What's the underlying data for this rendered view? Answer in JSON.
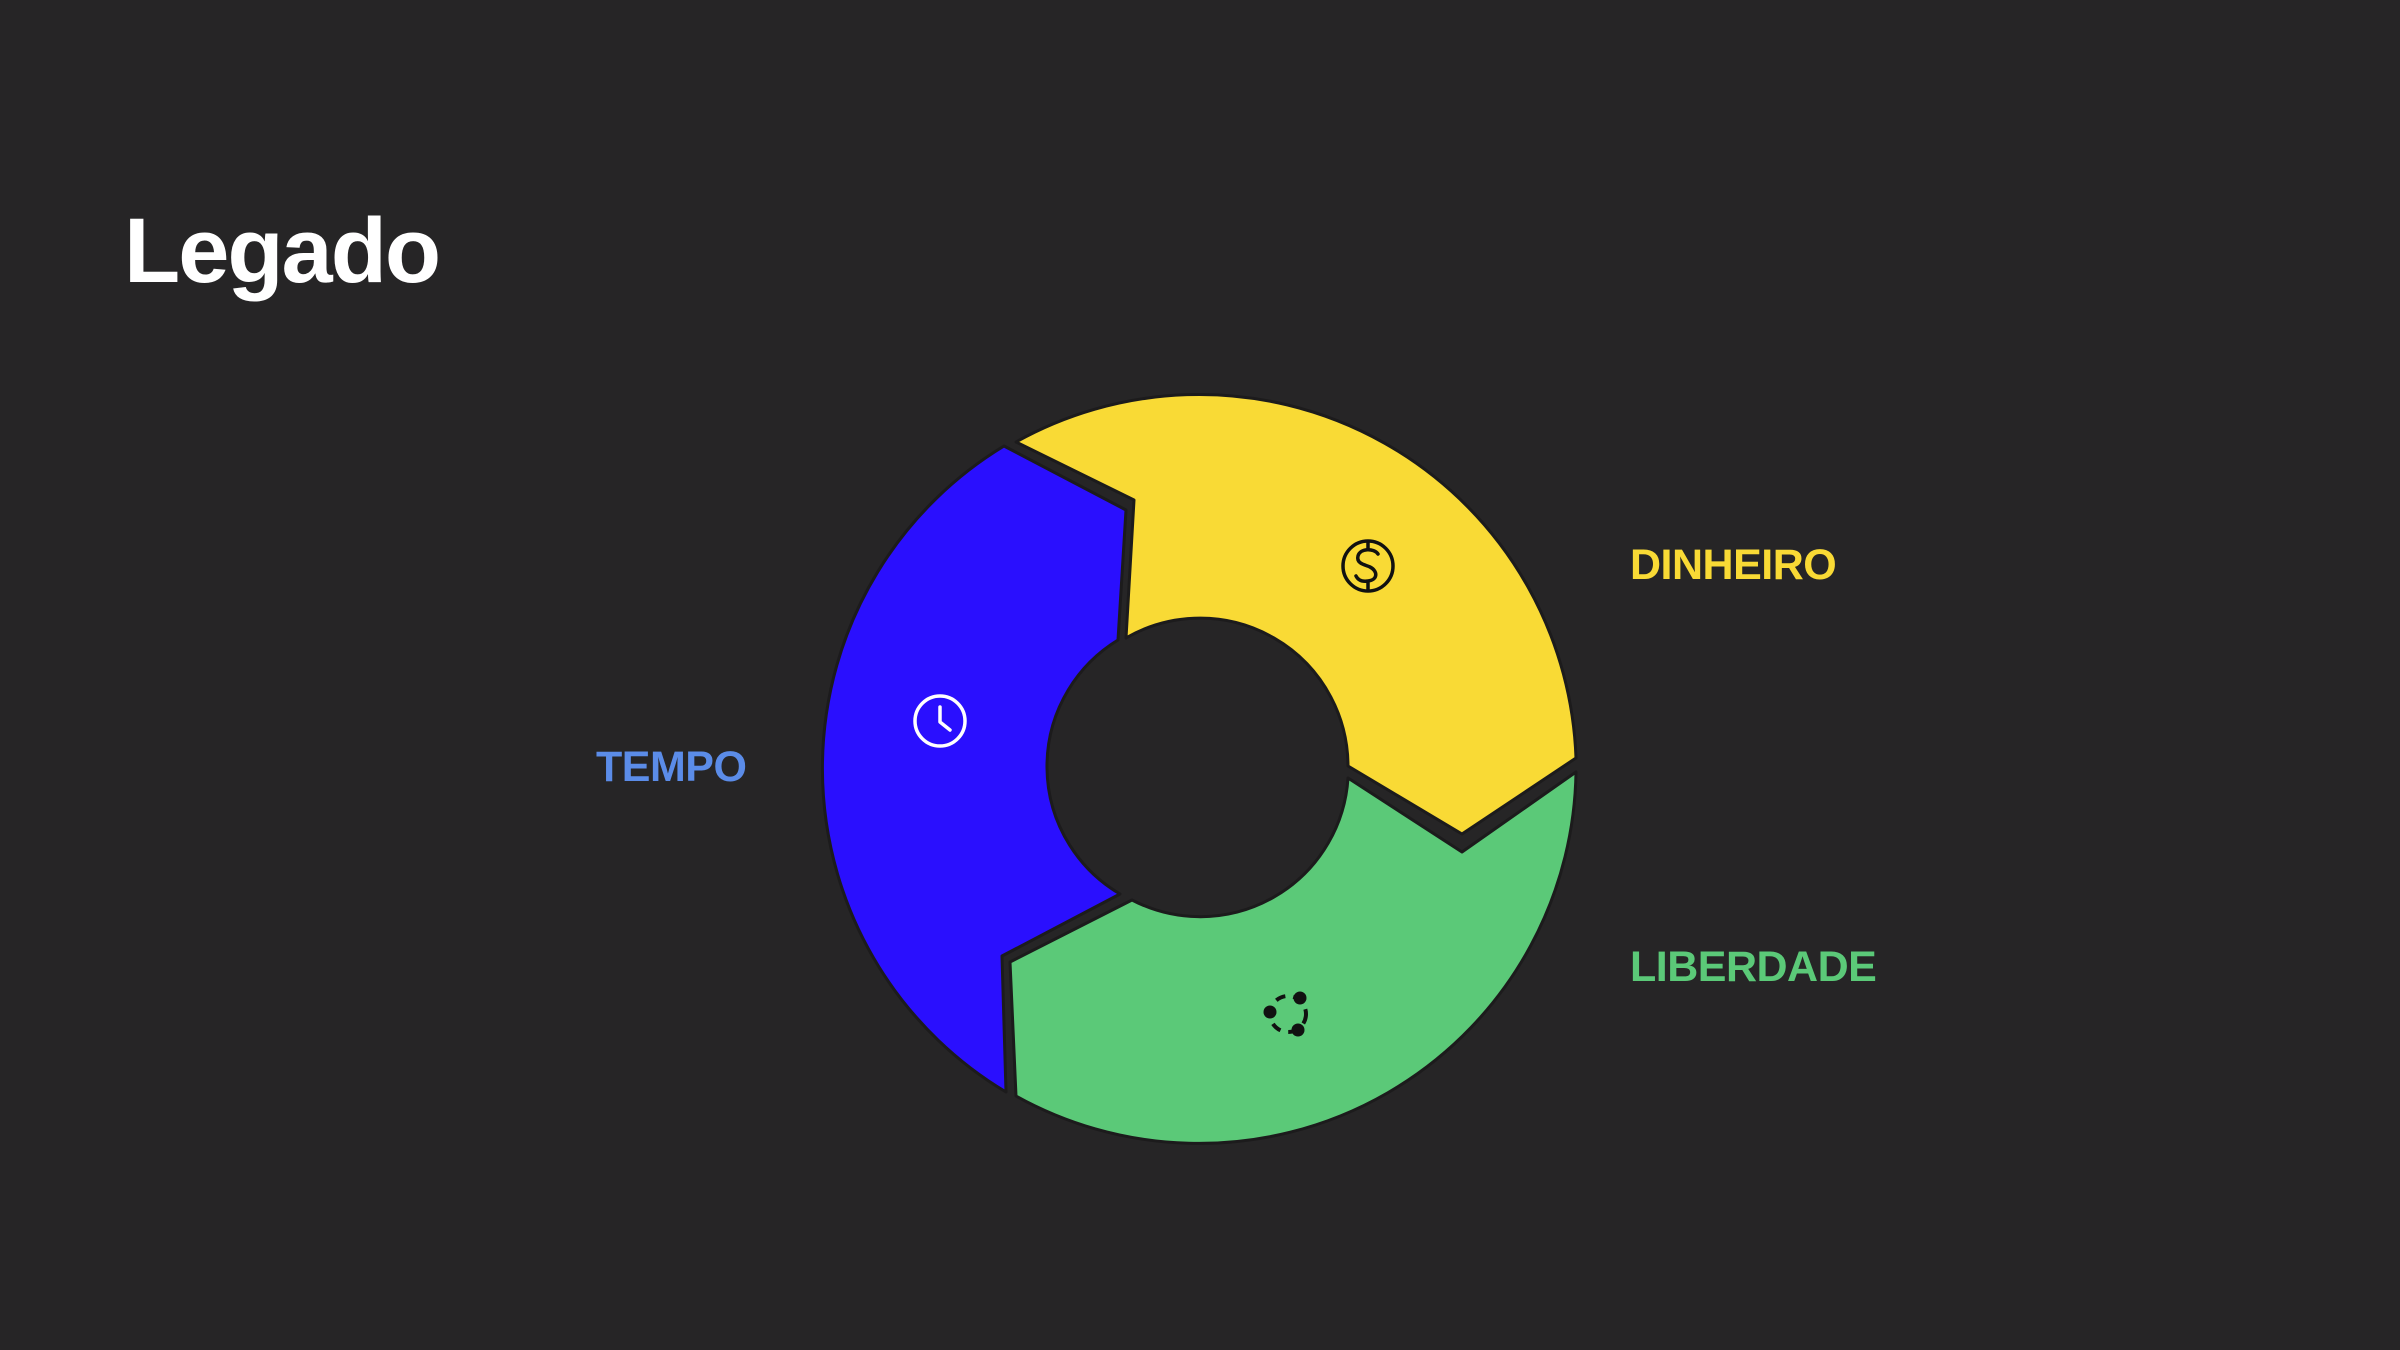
{
  "title": "Legado",
  "colors": {
    "background": "#262526",
    "title": "#ffffff",
    "dinheiro": "#f9da35",
    "liberdade": "#5bc978",
    "tempo": "#2a0ffe",
    "tempo_label": "#5b8ce8",
    "icon_dark": "#111111",
    "icon_light": "#ffffff"
  },
  "segments": [
    {
      "key": "dinheiro",
      "label": "DINHEIRO",
      "icon": "dollar-circle-icon"
    },
    {
      "key": "liberdade",
      "label": "LIBERDADE",
      "icon": "connected-nodes-icon"
    },
    {
      "key": "tempo",
      "label": "TEMPO",
      "icon": "clock-icon"
    }
  ]
}
